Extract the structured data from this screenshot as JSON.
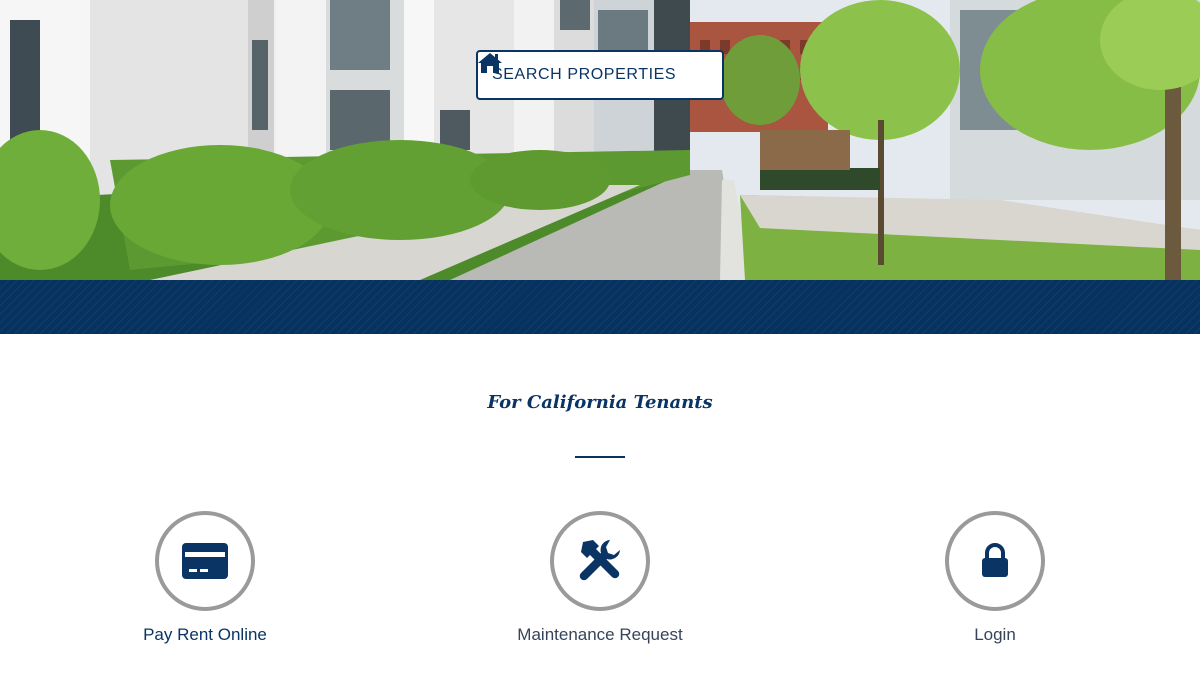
{
  "hero": {
    "search_button_label": "SEARCH PROPERTIES",
    "search_icon": "home-icon"
  },
  "section": {
    "title": "For California Tenants"
  },
  "services": [
    {
      "label": "Pay Rent Online",
      "icon": "credit-card-icon"
    },
    {
      "label": "Maintenance Request",
      "icon": "tools-icon"
    },
    {
      "label": "Login",
      "icon": "lock-icon"
    }
  ],
  "colors": {
    "brand_navy": "#0a3463",
    "band": "#06325f",
    "circle_border": "#9a9a9a"
  }
}
